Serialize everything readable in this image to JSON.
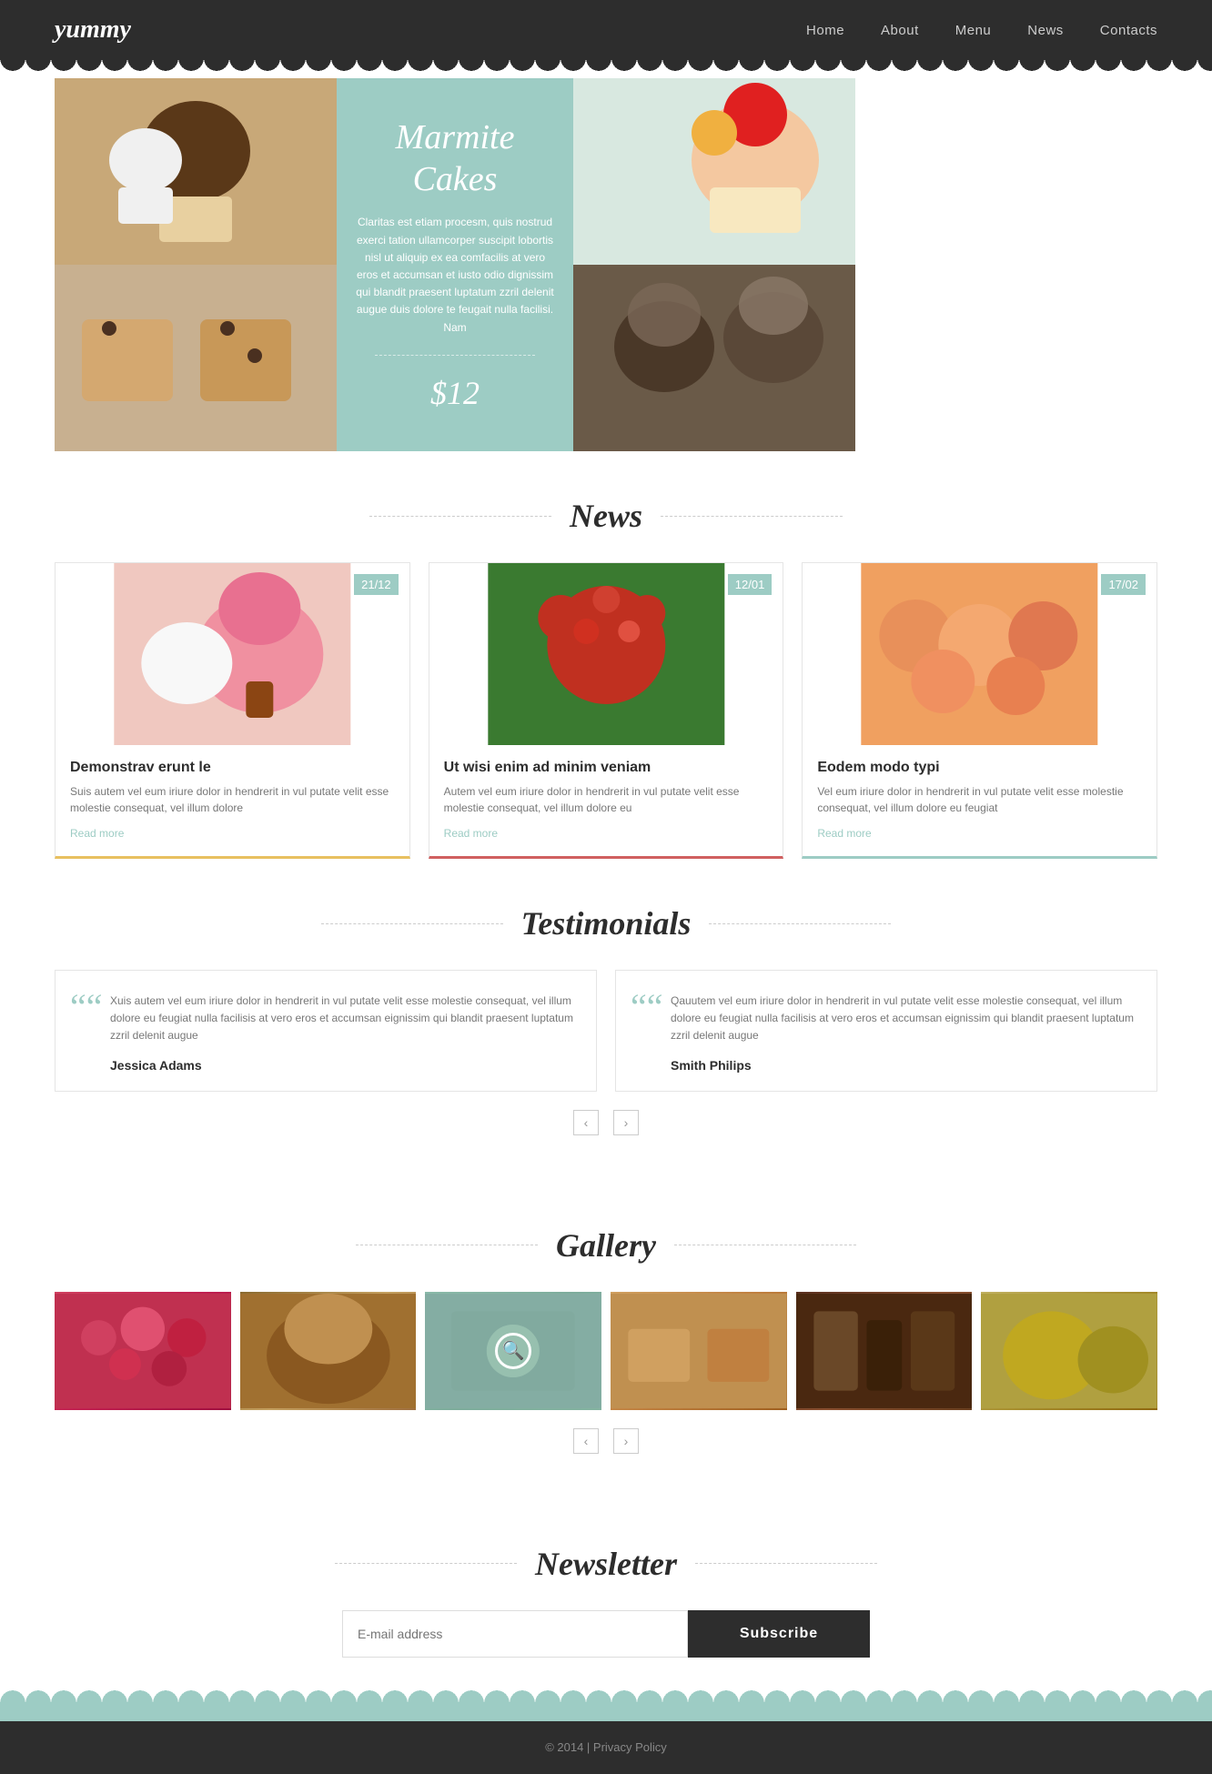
{
  "nav": {
    "logo": "yummy",
    "links": [
      {
        "label": "Home",
        "href": "#"
      },
      {
        "label": "About",
        "href": "#"
      },
      {
        "label": "Menu",
        "href": "#"
      },
      {
        "label": "News",
        "href": "#"
      },
      {
        "label": "Contacts",
        "href": "#"
      }
    ]
  },
  "hero": {
    "title": "Marmite Cakes",
    "description": "Claritas est etiam procesm, quis nostrud exerci tation ullamcorper suscipit lobortis nisl ut aliquip ex ea comfacilis at vero eros et accumsan et iusto odio dignissim qui blandit praesent luptatum zzril delenit augue duis dolore te feugait nulla facilisi. Nam",
    "price": "$12"
  },
  "sections": {
    "news_title": "News",
    "testimonials_title": "Testimonials",
    "gallery_title": "Gallery",
    "newsletter_title": "Newsletter"
  },
  "news": {
    "cards": [
      {
        "date": "21/12",
        "headline": "Demonstrav erunt le",
        "text": "Suis autem vel eum iriure dolor in hendrerit in vul putate velit esse molestie consequat, vel illum dolore",
        "read_more": "Read more"
      },
      {
        "date": "12/01",
        "headline": "Ut wisi enim ad minim veniam",
        "text": "Autem vel eum iriure dolor in hendrerit in vul putate velit esse molestie consequat, vel illum dolore eu",
        "read_more": "Read more"
      },
      {
        "date": "17/02",
        "headline": "Eodem modo typi",
        "text": "Vel eum iriure dolor in hendrerit in vul putate velit esse molestie consequat, vel illum dolore eu feugiat",
        "read_more": "Read more"
      }
    ]
  },
  "testimonials": {
    "items": [
      {
        "text": "Xuis autem vel eum iriure dolor in hendrerit in vul putate velit esse molestie consequat, vel illum dolore eu feugiat nulla facilisis at vero eros et accumsan eignissim qui blandit praesent luptatum zzril delenit augue",
        "name": "Jessica Adams"
      },
      {
        "text": "Qauutem vel eum iriure dolor in hendrerit in vul putate velit esse molestie consequat, vel illum dolore eu feugiat nulla facilisis at vero eros et accumsan eignissim qui blandit praesent luptatum zzril delenit augue",
        "name": "Smith Philips"
      }
    ],
    "prev_label": "‹",
    "next_label": "›"
  },
  "newsletter": {
    "email_placeholder": "E-mail address",
    "subscribe_label": "Subscribe"
  },
  "footer": {
    "copyright": "© 2014 | Privacy Policy"
  }
}
